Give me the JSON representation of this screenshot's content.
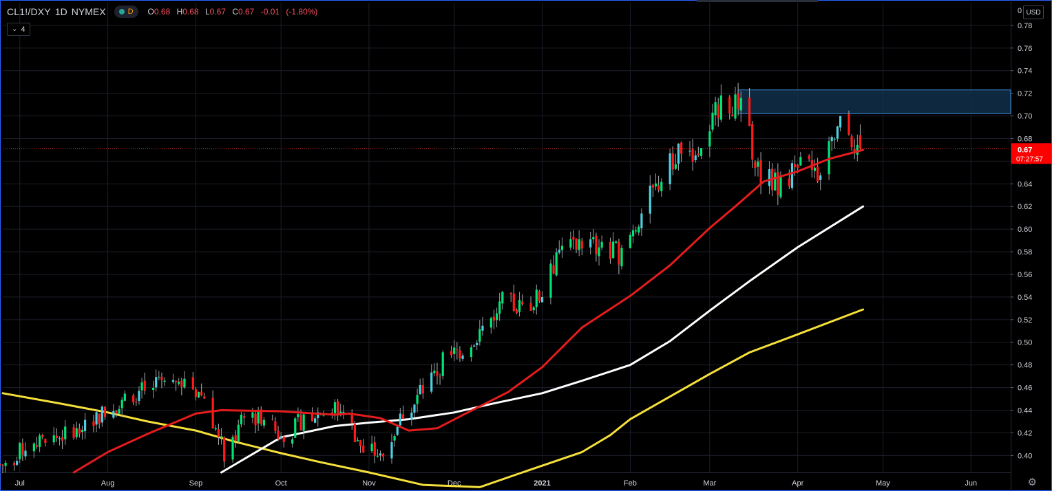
{
  "header": {
    "symbol": "CL1!/DXY",
    "interval": "1D",
    "exchange": "NYMEX",
    "status_letter": "D",
    "ohlc": {
      "open_key": "O",
      "open": "0.68",
      "high_key": "H",
      "high": "0.68",
      "low_key": "L",
      "low": "0.67",
      "close_key": "C",
      "close": "0.67",
      "change": "-0.01",
      "change_pct": "(-1.80%)"
    },
    "indicator_count": "4",
    "currency": "USD"
  },
  "last_price": {
    "value": 0.671,
    "label": "0.67",
    "countdown": "07:27:57",
    "color": "#ff0000"
  },
  "colors": {
    "background": "#000000",
    "grid": "#1c1f2a",
    "up_candle": "#00e676",
    "down_candle": "#ff1a1a",
    "up_alt": "#4dd0e1",
    "ma_fast": "#e51c1c",
    "ma_mid": "#ffffff",
    "ma_slow": "#f5e03a",
    "zone_fill": "#10304a",
    "zone_border": "#3d8ad6",
    "price_line": "#ff3b3b"
  },
  "chart_data": {
    "type": "candlestick",
    "y_axis": {
      "min": 0.385,
      "max": 0.8,
      "ticks": [
        0.4,
        0.42,
        0.44,
        0.46,
        0.48,
        0.5,
        0.52,
        0.54,
        0.56,
        0.58,
        0.6,
        0.62,
        0.64,
        0.66,
        0.68,
        0.7,
        0.72,
        0.74,
        0.76,
        0.78
      ],
      "tick_labels": [
        "0.40",
        "0.42",
        "0.44",
        "0.46",
        "0.48",
        "0.50",
        "0.52",
        "0.54",
        "0.56",
        "0.58",
        "0.60",
        "0.62",
        "0.64",
        "0.66",
        "0.68",
        "0.70",
        "0.72",
        "0.74",
        "0.76",
        "0.78"
      ],
      "top_label": "0",
      "side": "right"
    },
    "x_axis": {
      "start": "2020-06-25",
      "end": "2021-06-15",
      "ticks": [
        {
          "date": "2020-07-01",
          "label": "Jul"
        },
        {
          "date": "2020-08-01",
          "label": "Aug"
        },
        {
          "date": "2020-09-01",
          "label": "Sep"
        },
        {
          "date": "2020-10-01",
          "label": "Oct"
        },
        {
          "date": "2020-11-01",
          "label": "Nov"
        },
        {
          "date": "2020-12-01",
          "label": "Dec"
        },
        {
          "date": "2021-01-01",
          "label": "2021"
        },
        {
          "date": "2021-02-01",
          "label": "Feb"
        },
        {
          "date": "2021-03-01",
          "label": "Mar"
        },
        {
          "date": "2021-04-01",
          "label": "Apr"
        },
        {
          "date": "2021-05-01",
          "label": "May"
        },
        {
          "date": "2021-06-01",
          "label": "Jun"
        }
      ]
    },
    "grid": true,
    "closes": [
      [
        "2020-06-26",
        0.392
      ],
      [
        "2020-07-03",
        0.408
      ],
      [
        "2020-07-10",
        0.412
      ],
      [
        "2020-07-17",
        0.418
      ],
      [
        "2020-07-24",
        0.432
      ],
      [
        "2020-07-31",
        0.438
      ],
      [
        "2020-08-07",
        0.452
      ],
      [
        "2020-08-14",
        0.458
      ],
      [
        "2020-08-21",
        0.462
      ],
      [
        "2020-08-28",
        0.466
      ],
      [
        "2020-09-04",
        0.452
      ],
      [
        "2020-09-11",
        0.402
      ],
      [
        "2020-09-18",
        0.432
      ],
      [
        "2020-09-25",
        0.436
      ],
      [
        "2020-10-02",
        0.412
      ],
      [
        "2020-10-09",
        0.434
      ],
      [
        "2020-10-16",
        0.44
      ],
      [
        "2020-10-23",
        0.44
      ],
      [
        "2020-10-30",
        0.404
      ],
      [
        "2020-11-06",
        0.4
      ],
      [
        "2020-11-13",
        0.438
      ],
      [
        "2020-11-20",
        0.458
      ],
      [
        "2020-11-27",
        0.482
      ],
      [
        "2020-12-04",
        0.495
      ],
      [
        "2020-12-11",
        0.512
      ],
      [
        "2020-12-18",
        0.535
      ],
      [
        "2020-12-25",
        0.53
      ],
      [
        "2021-01-01",
        0.542
      ],
      [
        "2021-01-08",
        0.585
      ],
      [
        "2021-01-15",
        0.59
      ],
      [
        "2021-01-22",
        0.582
      ],
      [
        "2021-01-29",
        0.578
      ],
      [
        "2021-02-05",
        0.615
      ],
      [
        "2021-02-12",
        0.645
      ],
      [
        "2021-02-19",
        0.672
      ],
      [
        "2021-02-26",
        0.666
      ],
      [
        "2021-03-05",
        0.715
      ],
      [
        "2021-03-12",
        0.708
      ],
      [
        "2021-03-19",
        0.645
      ],
      [
        "2021-03-26",
        0.64
      ],
      [
        "2021-04-02",
        0.655
      ],
      [
        "2021-04-09",
        0.65
      ],
      [
        "2021-04-16",
        0.692
      ],
      [
        "2021-04-23",
        0.671
      ]
    ],
    "resistance_zone": {
      "y_low": 0.702,
      "y_high": 0.723,
      "start": "2021-03-11"
    },
    "series": [
      {
        "id": "ma_fast",
        "points": [
          [
            "2020-07-20",
            0.385
          ],
          [
            "2020-08-01",
            0.403
          ],
          [
            "2020-08-15",
            0.419
          ],
          [
            "2020-09-01",
            0.437
          ],
          [
            "2020-09-10",
            0.44
          ],
          [
            "2020-10-01",
            0.439
          ],
          [
            "2020-10-20",
            0.436
          ],
          [
            "2020-10-25",
            0.437
          ],
          [
            "2020-11-05",
            0.433
          ],
          [
            "2020-11-15",
            0.422
          ],
          [
            "2020-11-25",
            0.424
          ],
          [
            "2020-12-05",
            0.437
          ],
          [
            "2020-12-20",
            0.456
          ],
          [
            "2021-01-01",
            0.478
          ],
          [
            "2021-01-15",
            0.513
          ],
          [
            "2021-02-01",
            0.541
          ],
          [
            "2021-02-15",
            0.568
          ],
          [
            "2021-03-01",
            0.601
          ],
          [
            "2021-03-10",
            0.62
          ],
          [
            "2021-03-20",
            0.642
          ],
          [
            "2021-04-01",
            0.651
          ],
          [
            "2021-04-12",
            0.662
          ],
          [
            "2021-04-24",
            0.67
          ]
        ]
      },
      {
        "id": "ma_mid",
        "points": [
          [
            "2020-09-10",
            0.385
          ],
          [
            "2020-10-01",
            0.416
          ],
          [
            "2020-10-20",
            0.426
          ],
          [
            "2020-11-01",
            0.429
          ],
          [
            "2020-11-15",
            0.432
          ],
          [
            "2020-12-01",
            0.438
          ],
          [
            "2020-12-15",
            0.446
          ],
          [
            "2021-01-01",
            0.455
          ],
          [
            "2021-01-15",
            0.466
          ],
          [
            "2021-02-01",
            0.48
          ],
          [
            "2021-02-15",
            0.501
          ],
          [
            "2021-03-01",
            0.528
          ],
          [
            "2021-03-15",
            0.554
          ],
          [
            "2021-04-01",
            0.584
          ],
          [
            "2021-04-24",
            0.62
          ]
        ]
      },
      {
        "id": "ma_slow",
        "points": [
          [
            "2020-06-25",
            0.455
          ],
          [
            "2020-07-15",
            0.446
          ],
          [
            "2020-08-01",
            0.438
          ],
          [
            "2020-08-15",
            0.43
          ],
          [
            "2020-09-01",
            0.422
          ],
          [
            "2020-09-15",
            0.412
          ],
          [
            "2020-10-01",
            0.402
          ],
          [
            "2020-10-15",
            0.394
          ],
          [
            "2020-11-01",
            0.385
          ],
          [
            "2020-11-20",
            0.374
          ],
          [
            "2020-12-10",
            0.372
          ],
          [
            "2020-12-25",
            0.385
          ],
          [
            "2021-01-15",
            0.403
          ],
          [
            "2021-01-25",
            0.418
          ],
          [
            "2021-02-01",
            0.432
          ],
          [
            "2021-02-15",
            0.452
          ],
          [
            "2021-03-01",
            0.472
          ],
          [
            "2021-03-15",
            0.491
          ],
          [
            "2021-04-01",
            0.507
          ],
          [
            "2021-04-24",
            0.529
          ]
        ]
      }
    ]
  }
}
